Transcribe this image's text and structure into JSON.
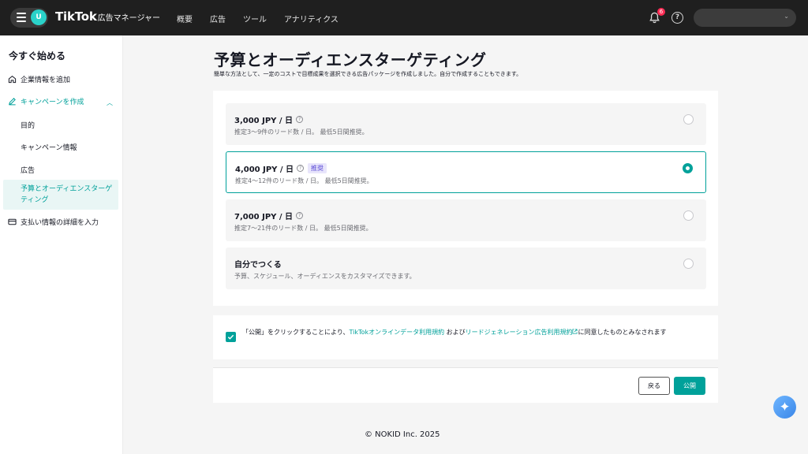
{
  "header": {
    "avatar_letter": "U",
    "brand": "TikTok",
    "brand_sub": "広告マネージャー",
    "nav": [
      "概要",
      "広告",
      "ツール",
      "アナリティクス"
    ],
    "notification_count": "6",
    "help_glyph": "?"
  },
  "sidebar": {
    "title": "今すぐ始める",
    "items": [
      {
        "label": "企業情報を追加",
        "icon": "home-icon"
      },
      {
        "label": "キャンペーンを作成",
        "icon": "edit-icon"
      },
      {
        "label": "支払い情報の詳細を入力",
        "icon": "card-icon"
      }
    ],
    "subitems": [
      "目的",
      "キャンペーン情報",
      "広告",
      "予算とオーディエンスターゲティング"
    ]
  },
  "main": {
    "title": "予算とオーディエンスターゲティング",
    "subtitle": "簡単な方法として、一定のコストで目標成果を選択できる広告パッケージを作成しました。自分で作成することもできます。",
    "options": [
      {
        "title": "3,000 JPY / 日",
        "badge": "",
        "desc": "推定3〜9件のリード数 / 日。 最低5日間推奨。",
        "selected": false
      },
      {
        "title": "4,000 JPY / 日",
        "badge": "推奨",
        "desc": "推定4〜12件のリード数 / 日。 最低5日間推奨。",
        "selected": true
      },
      {
        "title": "7,000 JPY / 日",
        "badge": "",
        "desc": "推定7〜21件のリード数 / 日。 最低5日間推奨。",
        "selected": false
      },
      {
        "title": "自分でつくる",
        "badge": "",
        "desc": "予算、スケジュール、オーディエンスをカスタマイズできます。",
        "selected": false
      }
    ],
    "consent": {
      "prefix": "「公開」をクリックすることにより、",
      "link1": "TikTokオンラインデータ利用規約",
      "mid": " および",
      "link2": "リードジェネレーション広告利用規約",
      "suffix": "に同意したものとみなされます",
      "checked": true
    },
    "buttons": {
      "back": "戻る",
      "publish": "公開"
    }
  },
  "footer": {
    "copyright": "© NOKID Inc. 2025"
  },
  "colors": {
    "accent": "#00a19a",
    "topbar": "#1f1f1f",
    "badge_bg": "#e8e5fb"
  }
}
